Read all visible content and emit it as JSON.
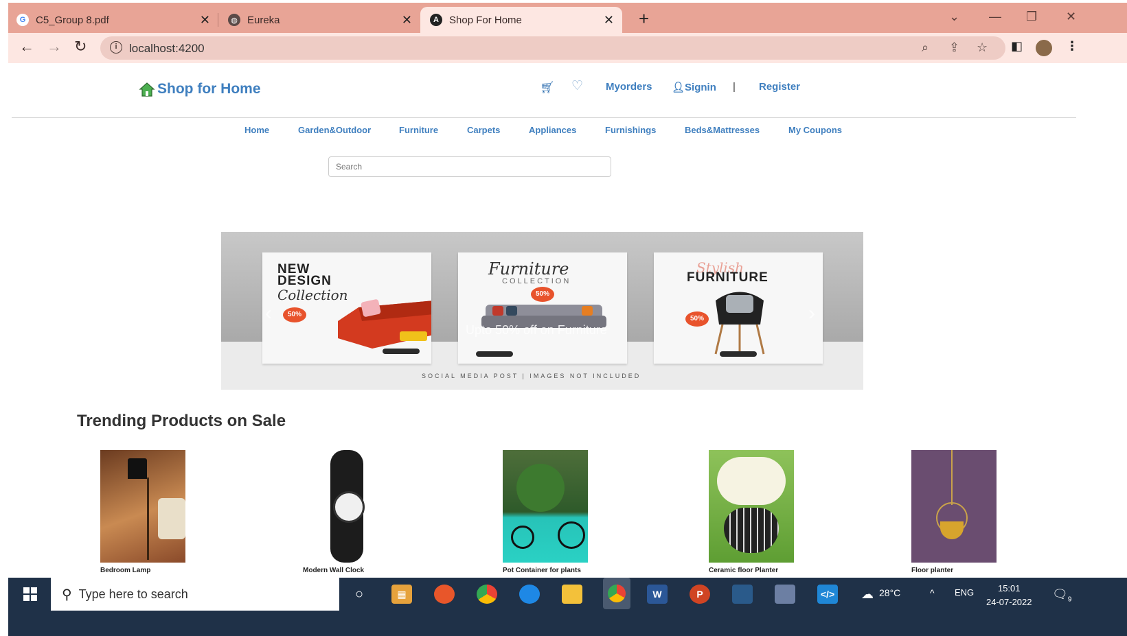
{
  "browser": {
    "tabs": [
      {
        "title": "C5_Group 8.pdf",
        "icon": "google-icon"
      },
      {
        "title": "Eureka",
        "icon": "globe-icon"
      },
      {
        "title": "Shop For Home",
        "icon": "angular-icon"
      }
    ],
    "url": "localhost:4200"
  },
  "header": {
    "brand": "Shop for Home",
    "myorders": "Myorders",
    "signin": "Signin",
    "separator": "|",
    "register": "Register"
  },
  "nav": {
    "items": [
      "Home",
      "Garden&Outdoor",
      "Furniture",
      "Carpets",
      "Appliances",
      "Furnishings",
      "Beds&Mattresses",
      "My Coupons"
    ]
  },
  "search": {
    "placeholder": "Search"
  },
  "carousel": {
    "slides": [
      {
        "line1": "NEW",
        "line2": "DESIGN",
        "script": "Collection",
        "badge": "50%"
      },
      {
        "script": "Furniture",
        "sub": "COLLECTION",
        "badge": "50%",
        "caption": "Upto 50% off on Furniture"
      },
      {
        "script": "Stylish",
        "title": "FURNITURE",
        "badge": "50%"
      }
    ],
    "footer": "SOCIAL MEDIA POST | IMAGES NOT INCLUDED"
  },
  "trending": {
    "title": "Trending Products on Sale",
    "products": [
      {
        "name": "Bedroom Lamp"
      },
      {
        "name": "Modern Wall Clock"
      },
      {
        "name": "Pot Container for plants"
      },
      {
        "name": "Ceramic floor Planter"
      },
      {
        "name": "Floor planter"
      }
    ]
  },
  "taskbar": {
    "search_placeholder": "Type here to search",
    "weather": "28°C",
    "lang": "ENG",
    "time": "15:01",
    "date": "24-07-2022",
    "notifications": "9"
  },
  "colors": {
    "link": "#3f7fbf",
    "tabstrip": "#e8a496",
    "taskbar": "#1f3148",
    "badge": "#e8532c"
  }
}
